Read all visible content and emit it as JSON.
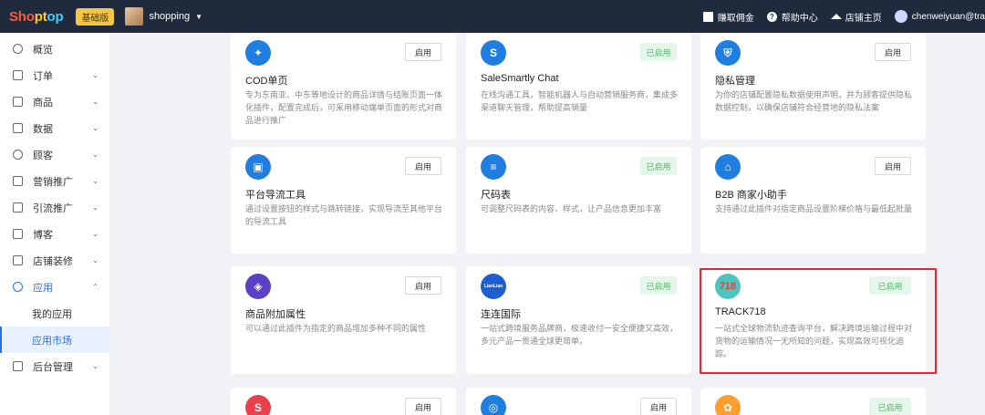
{
  "topbar": {
    "logo": [
      "Sho",
      "pt",
      "op"
    ],
    "plan_badge": "基础版",
    "shop_name": "shopping",
    "links": [
      {
        "label": "赚取佣金",
        "icon": "wallet-icon"
      },
      {
        "label": "帮助中心",
        "icon": "help-icon"
      },
      {
        "label": "店铺主页",
        "icon": "home-icon"
      }
    ],
    "user_name": "chenweiyuan@tra"
  },
  "sidebar": {
    "items": [
      {
        "label": "概览",
        "icon": "dashboard-icon",
        "chevron": ""
      },
      {
        "label": "订单",
        "icon": "order-icon",
        "chevron": "⌄"
      },
      {
        "label": "商品",
        "icon": "product-icon",
        "chevron": "⌄"
      },
      {
        "label": "数据",
        "icon": "data-icon",
        "chevron": "⌄"
      },
      {
        "label": "顾客",
        "icon": "customer-icon",
        "chevron": "⌄"
      },
      {
        "label": "营销推广",
        "icon": "marketing-icon",
        "chevron": "⌄"
      },
      {
        "label": "引流推广",
        "icon": "traffic-icon",
        "chevron": "⌄"
      },
      {
        "label": "博客",
        "icon": "blog-icon",
        "chevron": "⌄"
      },
      {
        "label": "店铺装修",
        "icon": "theme-icon",
        "chevron": "⌄"
      }
    ],
    "apps": {
      "label": "应用",
      "icon": "apps-icon",
      "chevron": "⌃"
    },
    "apps_sub": [
      "我的应用",
      "应用市场"
    ],
    "admin": {
      "label": "后台管理",
      "icon": "admin-icon",
      "chevron": "⌄"
    }
  },
  "apps": [
    {
      "name": "COD单页",
      "status": "启用",
      "enabled": false,
      "icon": "cod-icon",
      "icon_color": "#1f7ee0",
      "icon_text": "",
      "desc": "专为东南亚、中东等地设计的商品详情与结账页面一体化插件，配置完成后，可采用移动端单页面的形式对商品进行推广"
    },
    {
      "name": "SaleSmartly Chat",
      "status": "已启用",
      "enabled": true,
      "icon": "salesmartly-icon",
      "icon_color": "#1f7ee0",
      "icon_text": "S",
      "desc": "在线沟通工具，智能机器人与自动营销服务商，集成多渠道聊天管理，帮助提高销量"
    },
    {
      "name": "隐私管理",
      "status": "启用",
      "enabled": false,
      "icon": "privacy-icon",
      "icon_color": "#1f7ee0",
      "icon_text": "",
      "desc": "为你的店铺配置隐私数据使用声明，并为顾客提供隐私数据控制，以确保店铺符合经营地的隐私法案"
    },
    {
      "name": "平台导流工具",
      "status": "启用",
      "enabled": false,
      "icon": "traffic-tool-icon",
      "icon_color": "#1f7ee0",
      "icon_text": "",
      "desc": "通过设置按钮的样式与跳转链接，实现导流至其他平台的导流工具"
    },
    {
      "name": "尺码表",
      "status": "已启用",
      "enabled": true,
      "icon": "size-chart-icon",
      "icon_color": "#1f7ee0",
      "icon_text": "",
      "desc": "可调整尺码表的内容、样式，让产品信息更加丰富"
    },
    {
      "name": "B2B 商家小助手",
      "status": "启用",
      "enabled": false,
      "icon": "b2b-icon",
      "icon_color": "#1f7ee0",
      "icon_text": "",
      "desc": "支持通过此插件对指定商品设置阶梯价格与最低起批量"
    },
    {
      "name": "商品附加属性",
      "status": "启用",
      "enabled": false,
      "icon": "product-attr-icon",
      "icon_color": "#5b3fc4",
      "icon_text": "",
      "desc": "可以通过此插件为指定的商品增加多种不同的属性"
    },
    {
      "name": "连连国际",
      "status": "已启用",
      "enabled": true,
      "icon": "lianlian-icon",
      "icon_color": "#1e5fd0",
      "icon_text": "LianLian",
      "desc": "一站式跨境服务品牌商，极速收付一安全便捷又高效，多元产品一贯通全球更简单。"
    },
    {
      "name": "TRACK718",
      "status": "已启用",
      "enabled": true,
      "icon": "track718-icon",
      "icon_color": "#4fc3c0",
      "icon_text": "718",
      "desc": "一站式全球物流轨迹查询平台，解决跨境运输过程中对货物的运输情况一无所知的问题，实现高效可视化追踪。"
    },
    {
      "name": "",
      "status": "启用",
      "enabled": false,
      "icon": "app-icon",
      "icon_color": "#e8414c",
      "icon_text": "S",
      "desc": ""
    },
    {
      "name": "",
      "status": "启用",
      "enabled": false,
      "icon": "app-icon",
      "icon_color": "#1f7ee0",
      "icon_text": "",
      "desc": ""
    },
    {
      "name": "",
      "status": "已启用",
      "enabled": true,
      "icon": "app-icon",
      "icon_color": "#ff9e2c",
      "icon_text": "",
      "desc": ""
    }
  ]
}
